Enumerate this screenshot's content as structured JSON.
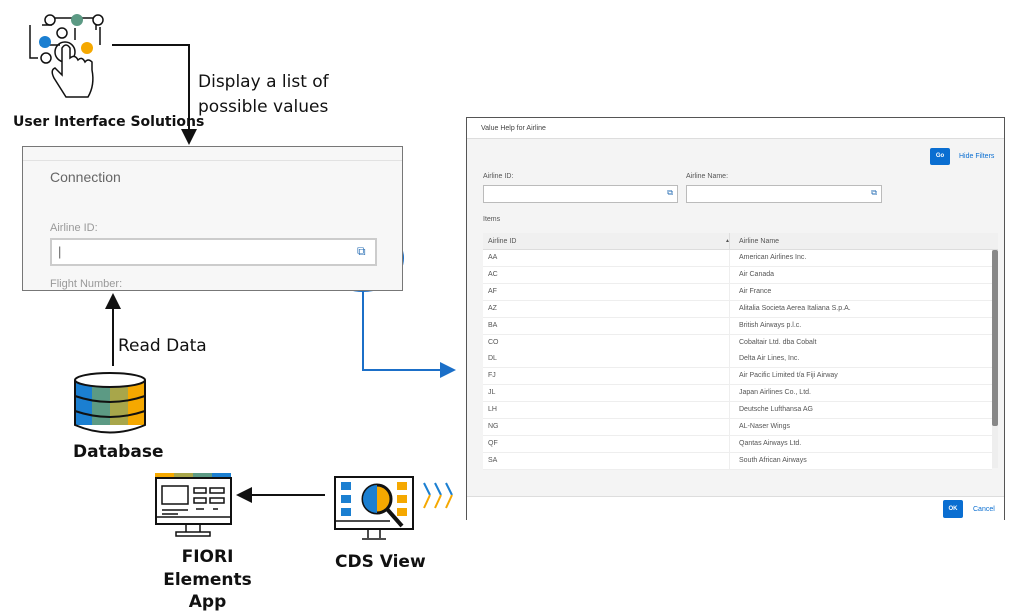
{
  "diagram": {
    "ui_solutions_label": "User Interface Solutions",
    "display_label_line1": "Display a list of",
    "display_label_line2": "possible values",
    "read_data_label": "Read Data",
    "database_label": "Database",
    "fiori_label_line1": "FIORI",
    "fiori_label_line2": "Elements App",
    "cds_view_label": "CDS View",
    "colors": {
      "blue": "#1b7fd1",
      "teal": "#5c9a84",
      "olive": "#a8a64a",
      "orange": "#f5a800",
      "accent_line": "#1b6fc8"
    }
  },
  "form": {
    "title": "Connection",
    "airline_id_label": "Airline ID:",
    "airline_id_value": "|",
    "flight_number_label": "Flight Number:",
    "value_help_icon": "value-help-icon"
  },
  "dialog": {
    "title": "Value Help for Airline",
    "go_label": "Go",
    "hide_filters_label": "Hide Filters",
    "filter_airline_id_label": "Airline ID:",
    "filter_airline_name_label": "Airline Name:",
    "items_label": "Items",
    "columns": [
      "Airline ID",
      "Airline Name"
    ],
    "sort_indicator": "▲",
    "rows": [
      [
        "AA",
        "American Airlines Inc."
      ],
      [
        "AC",
        "Air Canada"
      ],
      [
        "AF",
        "Air France"
      ],
      [
        "AZ",
        "Alitalia Societa Aerea Italiana S.p.A."
      ],
      [
        "BA",
        "British Airways p.l.c."
      ],
      [
        "CO",
        "Cobaltair Ltd. dba Cobalt"
      ],
      [
        "DL",
        "Delta Air Lines, Inc."
      ],
      [
        "FJ",
        "Air Pacific Limited t/a Fiji Airway"
      ],
      [
        "JL",
        "Japan Airlines Co., Ltd."
      ],
      [
        "LH",
        "Deutsche Lufthansa AG"
      ],
      [
        "NG",
        "AL-Naser Wings"
      ],
      [
        "QF",
        "Qantas Airways Ltd."
      ],
      [
        "SA",
        "South African Airways"
      ]
    ],
    "ok_label": "OK",
    "cancel_label": "Cancel"
  }
}
